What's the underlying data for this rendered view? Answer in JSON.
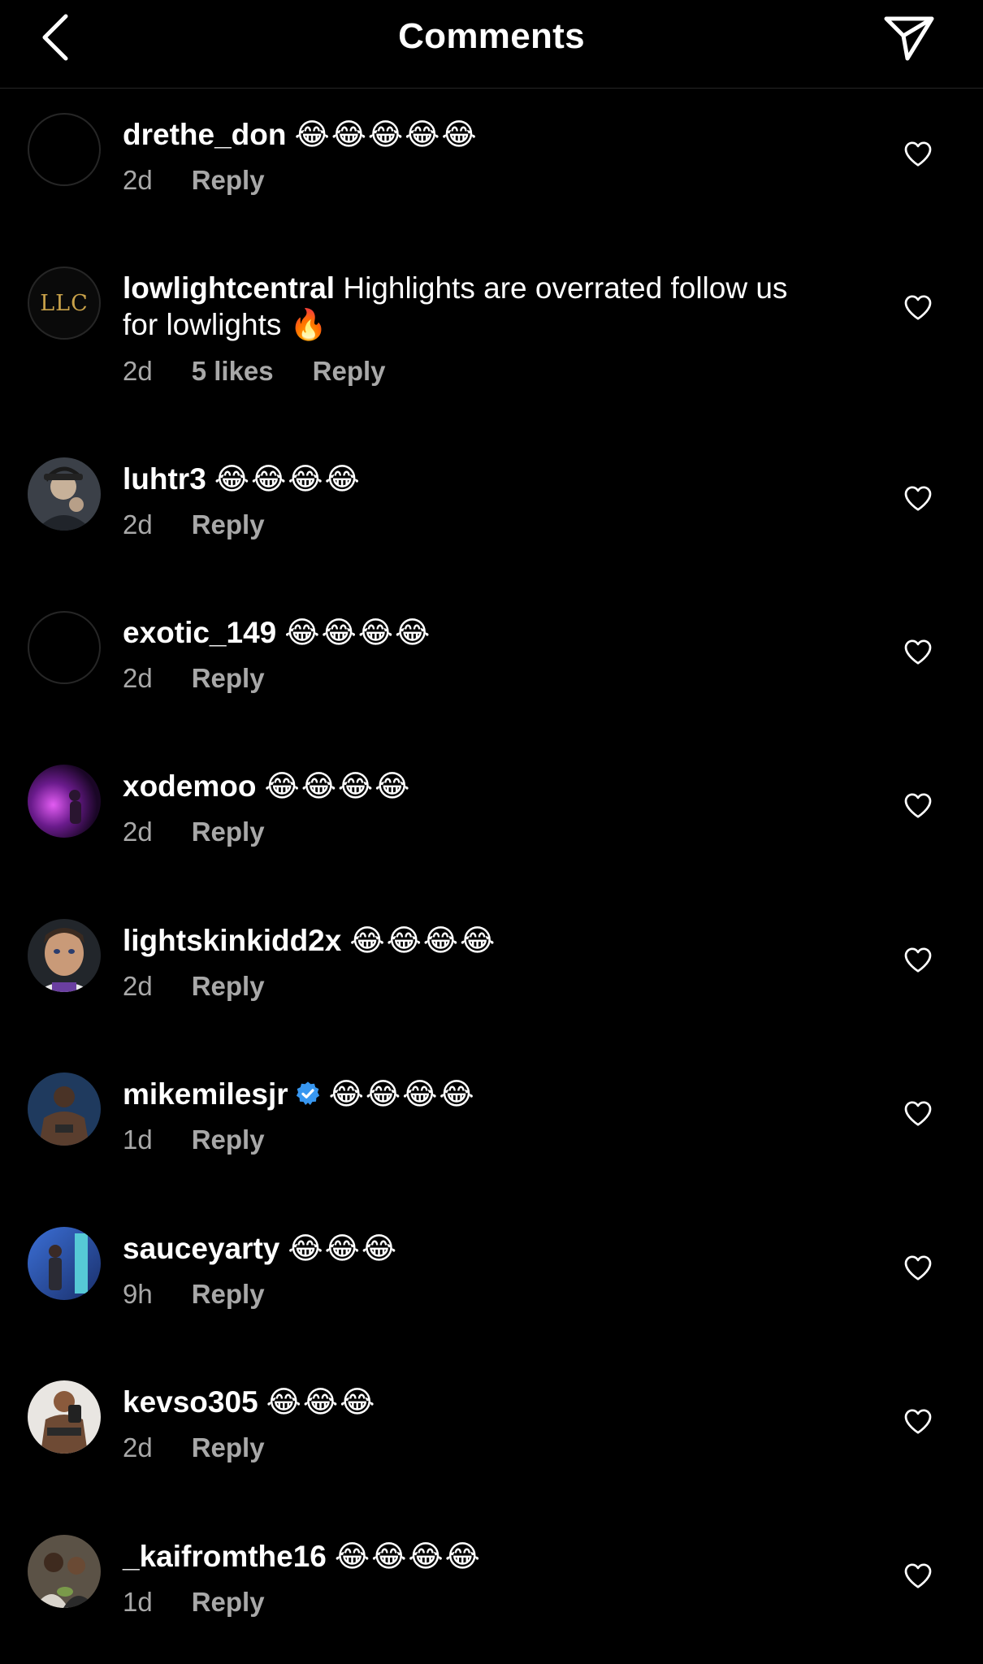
{
  "header": {
    "title": "Comments"
  },
  "icons": {
    "back": "chevron-left-icon",
    "send": "paper-plane-icon",
    "like": "heart-outline-icon"
  },
  "comments": [
    {
      "username": "drethe_don",
      "text": "😂😂😂😂😂",
      "time": "2d",
      "likes": "",
      "reply": "Reply",
      "avatar": "empty"
    },
    {
      "username": "lowlightcentral",
      "text": "Highlights are overrated follow us for lowlights 🔥",
      "time": "2d",
      "likes": "5 likes",
      "reply": "Reply",
      "avatar": "llc",
      "avatar_text": "LLC"
    },
    {
      "username": "luhtr3",
      "text": "😂😂😂😂",
      "time": "2d",
      "likes": "",
      "reply": "Reply",
      "avatar": "photo"
    },
    {
      "username": "exotic_149",
      "text": "😂😂😂😂",
      "time": "2d",
      "likes": "",
      "reply": "Reply",
      "avatar": "empty"
    },
    {
      "username": "xodemoo",
      "text": "😂😂😂😂",
      "time": "2d",
      "likes": "",
      "reply": "Reply",
      "avatar": "photo"
    },
    {
      "username": "lightskinkidd2x",
      "text": "😂😂😂😂",
      "time": "2d",
      "likes": "",
      "reply": "Reply",
      "avatar": "photo"
    },
    {
      "username": "mikemilesjr",
      "text": "😂😂😂😂",
      "time": "1d",
      "likes": "",
      "reply": "Reply",
      "avatar": "photo",
      "verified": true
    },
    {
      "username": "sauceyarty",
      "text": "😂😂😂",
      "time": "9h",
      "likes": "",
      "reply": "Reply",
      "avatar": "photo"
    },
    {
      "username": "kevso305",
      "text": "😂😂😂",
      "time": "2d",
      "likes": "",
      "reply": "Reply",
      "avatar": "photo"
    },
    {
      "username": "_kaifromthe16",
      "text": "😂😂😂😂",
      "time": "1d",
      "likes": "",
      "reply": "Reply",
      "avatar": "photo"
    }
  ]
}
